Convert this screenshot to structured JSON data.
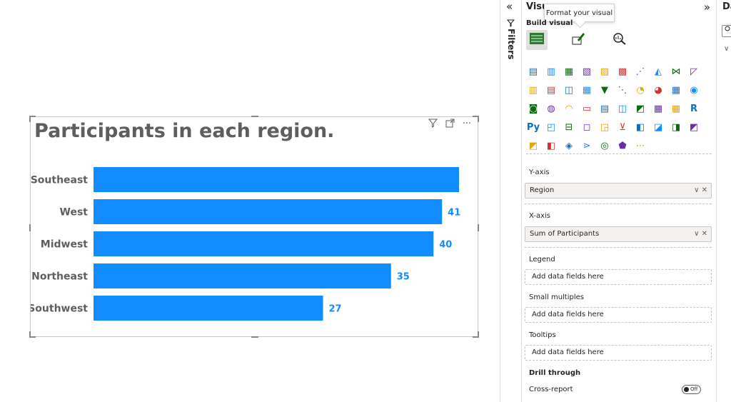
{
  "visual": {
    "title": "Participants in each region.",
    "header_icons": [
      "filter-icon",
      "focus-mode-icon",
      "more-options-icon"
    ]
  },
  "chart_data": {
    "type": "bar",
    "orientation": "horizontal",
    "categories": [
      "Southeast",
      "West",
      "Midwest",
      "Northeast",
      "Southwest"
    ],
    "values": [
      43,
      41,
      40,
      35,
      27
    ],
    "data_labels": [
      "",
      "41",
      "40",
      "35",
      "27"
    ],
    "bar_color": "#118dff",
    "label_color": "#118dff",
    "xlim": [
      0,
      43
    ],
    "title": "Participants in each region."
  },
  "filters_pane": {
    "label": "Filters",
    "collapse_glyph": "«"
  },
  "visualizations_pane": {
    "title": "Visu",
    "expand_glyph": "»",
    "tooltip": "Format your visual",
    "build_label": "Build visual",
    "tabs": [
      "build-visual-icon",
      "format-visual-icon",
      "analytics-icon"
    ],
    "gallery_icons": [
      "▤",
      "▥",
      "▦",
      "▧",
      "▨",
      "▩",
      "⋰",
      "◭",
      "⋈",
      "◸",
      "▥",
      "▤",
      "◫",
      "▦",
      "▼",
      "⋱",
      "◔",
      "◕",
      "▦",
      "◉",
      "◙",
      "◍",
      "◠",
      "▭",
      "▤",
      "◫",
      "◩",
      "▦",
      "▦",
      "R",
      "Py",
      "◰",
      "⊟",
      "◻",
      "◲",
      "⊻",
      "◧",
      "◪",
      "◨",
      "◩",
      "◩",
      "◧",
      "◈",
      "⋗",
      "◎",
      "⬟",
      "⋯"
    ],
    "wells": {
      "y_axis": {
        "label": "Y-axis",
        "field": "Region"
      },
      "x_axis": {
        "label": "X-axis",
        "field": "Sum of Participants"
      },
      "legend": {
        "label": "Legend",
        "placeholder": "Add data fields here"
      },
      "small_multiples": {
        "label": "Small multiples",
        "placeholder": "Add data fields here"
      },
      "tooltips": {
        "label": "Tooltips",
        "placeholder": "Add data fields here"
      }
    },
    "drill_through": "Drill through",
    "cross_report": "Cross-report",
    "toggle_state": "Off"
  },
  "data_pane": {
    "title": "Da"
  }
}
